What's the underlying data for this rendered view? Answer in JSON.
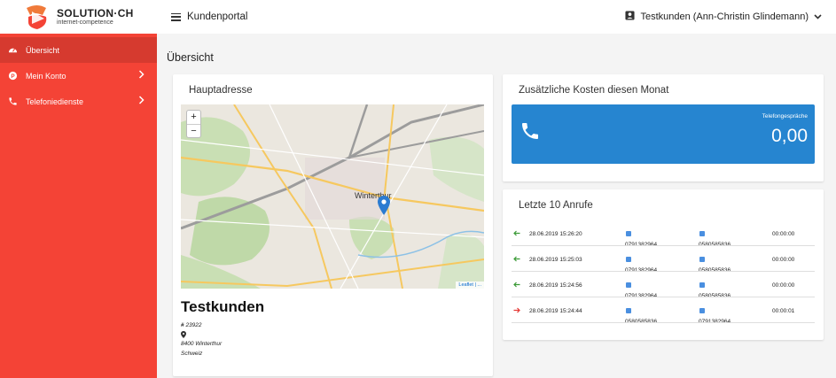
{
  "brand": {
    "name": "SOLUTION·CH",
    "tagline": "internet-competence",
    "colors": {
      "primary": "#f44336",
      "accent": "#2685d0",
      "incoming": "#3a9a35",
      "outgoing": "#e53935"
    }
  },
  "sidebar": {
    "items": [
      {
        "label": "Übersicht",
        "icon": "dashboard-icon",
        "active": true
      },
      {
        "label": "Mein Konto",
        "icon": "account-icon",
        "has_submenu": true
      },
      {
        "label": "Telefoniedienste",
        "icon": "phone-icon",
        "has_submenu": true
      }
    ]
  },
  "header": {
    "title": "Kundenportal",
    "user": "Testkunden (Ann-Christin Glindemann)"
  },
  "page": {
    "title": "Übersicht"
  },
  "address_card": {
    "title": "Hauptadresse",
    "map": {
      "zoom_in": "+",
      "zoom_out": "−",
      "attribution": "Leaflet | ...",
      "city_label": "Winterthur"
    },
    "name": "Testkunden",
    "customer_no": "23922",
    "postal_city": "8400 Winterthur",
    "country": "Schweiz"
  },
  "cost_card": {
    "title": "Zusätzliche Kosten diesen Monat",
    "label": "Telefongespräche",
    "value": "0,00"
  },
  "calls_card": {
    "title": "Letzte 10 Anrufe",
    "rows": [
      {
        "direction": "incoming",
        "time": "28.06.2019 15:26:20",
        "from": "0791382964",
        "to": "0580585836",
        "duration": "00:00:00"
      },
      {
        "direction": "incoming",
        "time": "28.06.2019 15:25:03",
        "from": "0791382964",
        "to": "0580585836",
        "duration": "00:00:00"
      },
      {
        "direction": "incoming",
        "time": "28.06.2019 15:24:56",
        "from": "0791382964",
        "to": "0580585836",
        "duration": "00:00:00"
      },
      {
        "direction": "outgoing",
        "time": "28.06.2019 15:24:44",
        "from": "0580585836",
        "to": "0791382964",
        "duration": "00:00:01"
      }
    ]
  }
}
